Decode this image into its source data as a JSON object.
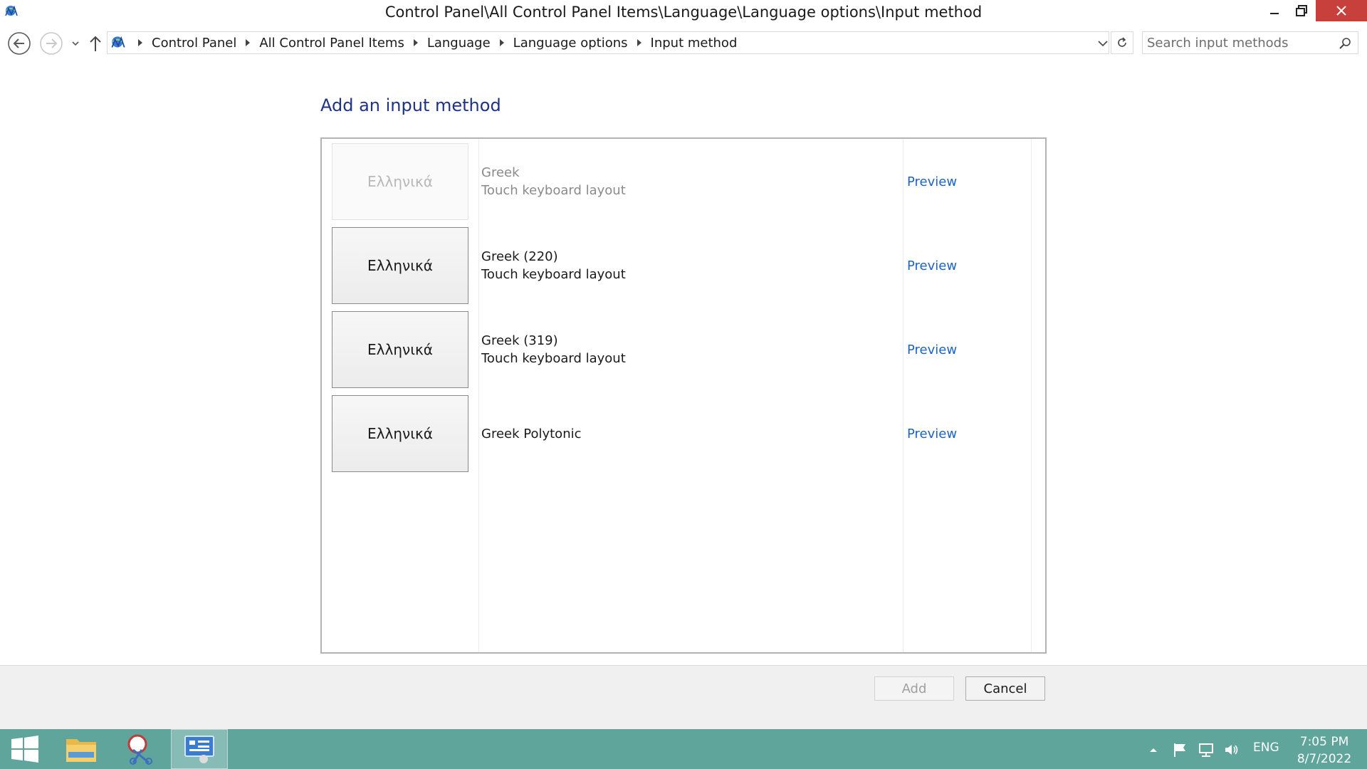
{
  "window": {
    "title": "Control Panel\\All Control Panel Items\\Language\\Language options\\Input method"
  },
  "address_bar": {
    "crumbs": [
      "Control Panel",
      "All Control Panel Items",
      "Language",
      "Language options",
      "Input method"
    ],
    "search_placeholder": "Search input methods"
  },
  "main": {
    "heading": "Add an input method",
    "input_methods": [
      {
        "tile_label": "Ελληνικά",
        "name": "Greek",
        "type": "Touch keyboard layout",
        "preview": "Preview",
        "enabled": false
      },
      {
        "tile_label": "Ελληνικά",
        "name": "Greek (220)",
        "type": "Touch keyboard layout",
        "preview": "Preview",
        "enabled": true
      },
      {
        "tile_label": "Ελληνικά",
        "name": "Greek (319)",
        "type": "Touch keyboard layout",
        "preview": "Preview",
        "enabled": true
      },
      {
        "tile_label": "Ελληνικά",
        "name": "Greek Polytonic",
        "type": "",
        "preview": "Preview",
        "enabled": true
      }
    ]
  },
  "footer": {
    "add_label": "Add",
    "cancel_label": "Cancel"
  },
  "taskbar": {
    "language": "ENG",
    "time": "7:05 PM",
    "date": "8/7/2022"
  },
  "colors": {
    "heading": "#1e3287",
    "link": "#1c63c5",
    "taskbar": "#5fa59c",
    "close_button": "#c7403b"
  }
}
